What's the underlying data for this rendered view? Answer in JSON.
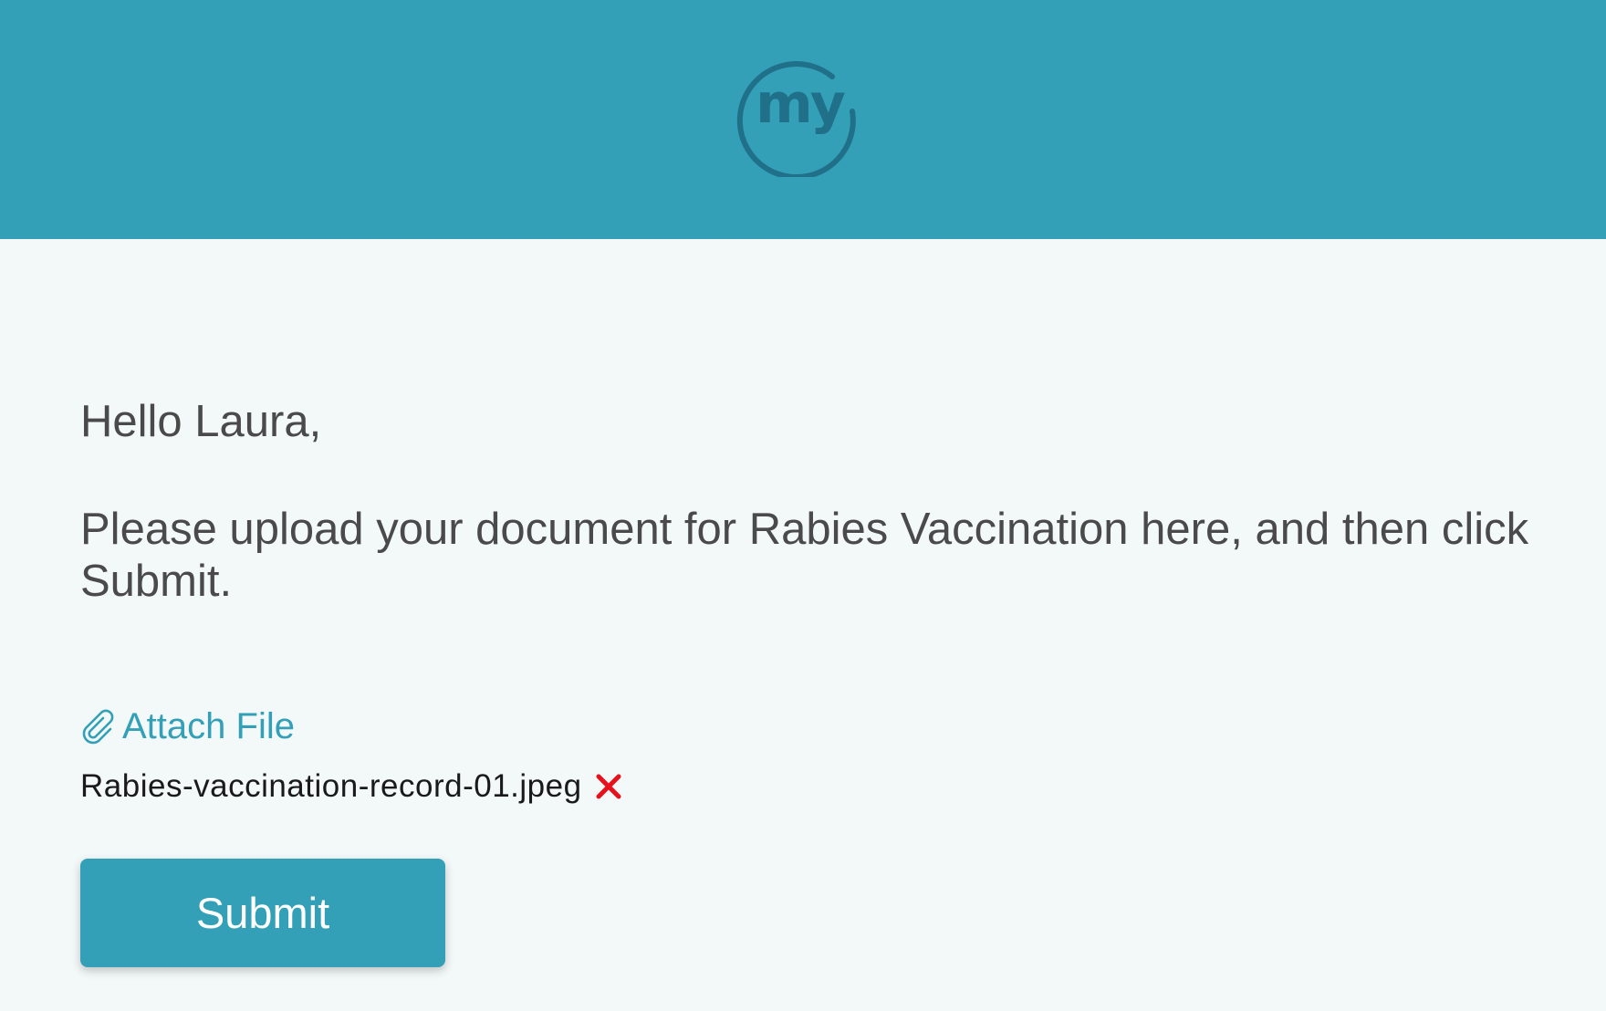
{
  "header": {
    "logo_text": "my",
    "logo_color": "#20708a",
    "background": "#33a0b8"
  },
  "message": {
    "greeting": "Hello Laura,",
    "instructions": "Please upload your document for Rabies Vaccination here, and then click Submit."
  },
  "attachment": {
    "attach_label": "Attach File",
    "attach_icon": "paperclip-icon",
    "file_name": "Rabies-vaccination-record-01.jpeg",
    "remove_icon": "close-icon",
    "remove_color": "#e8101a"
  },
  "actions": {
    "submit_label": "Submit"
  },
  "colors": {
    "accent": "#33a0b8",
    "page_background": "#f3f8f8",
    "text": "#4a4a4a"
  }
}
